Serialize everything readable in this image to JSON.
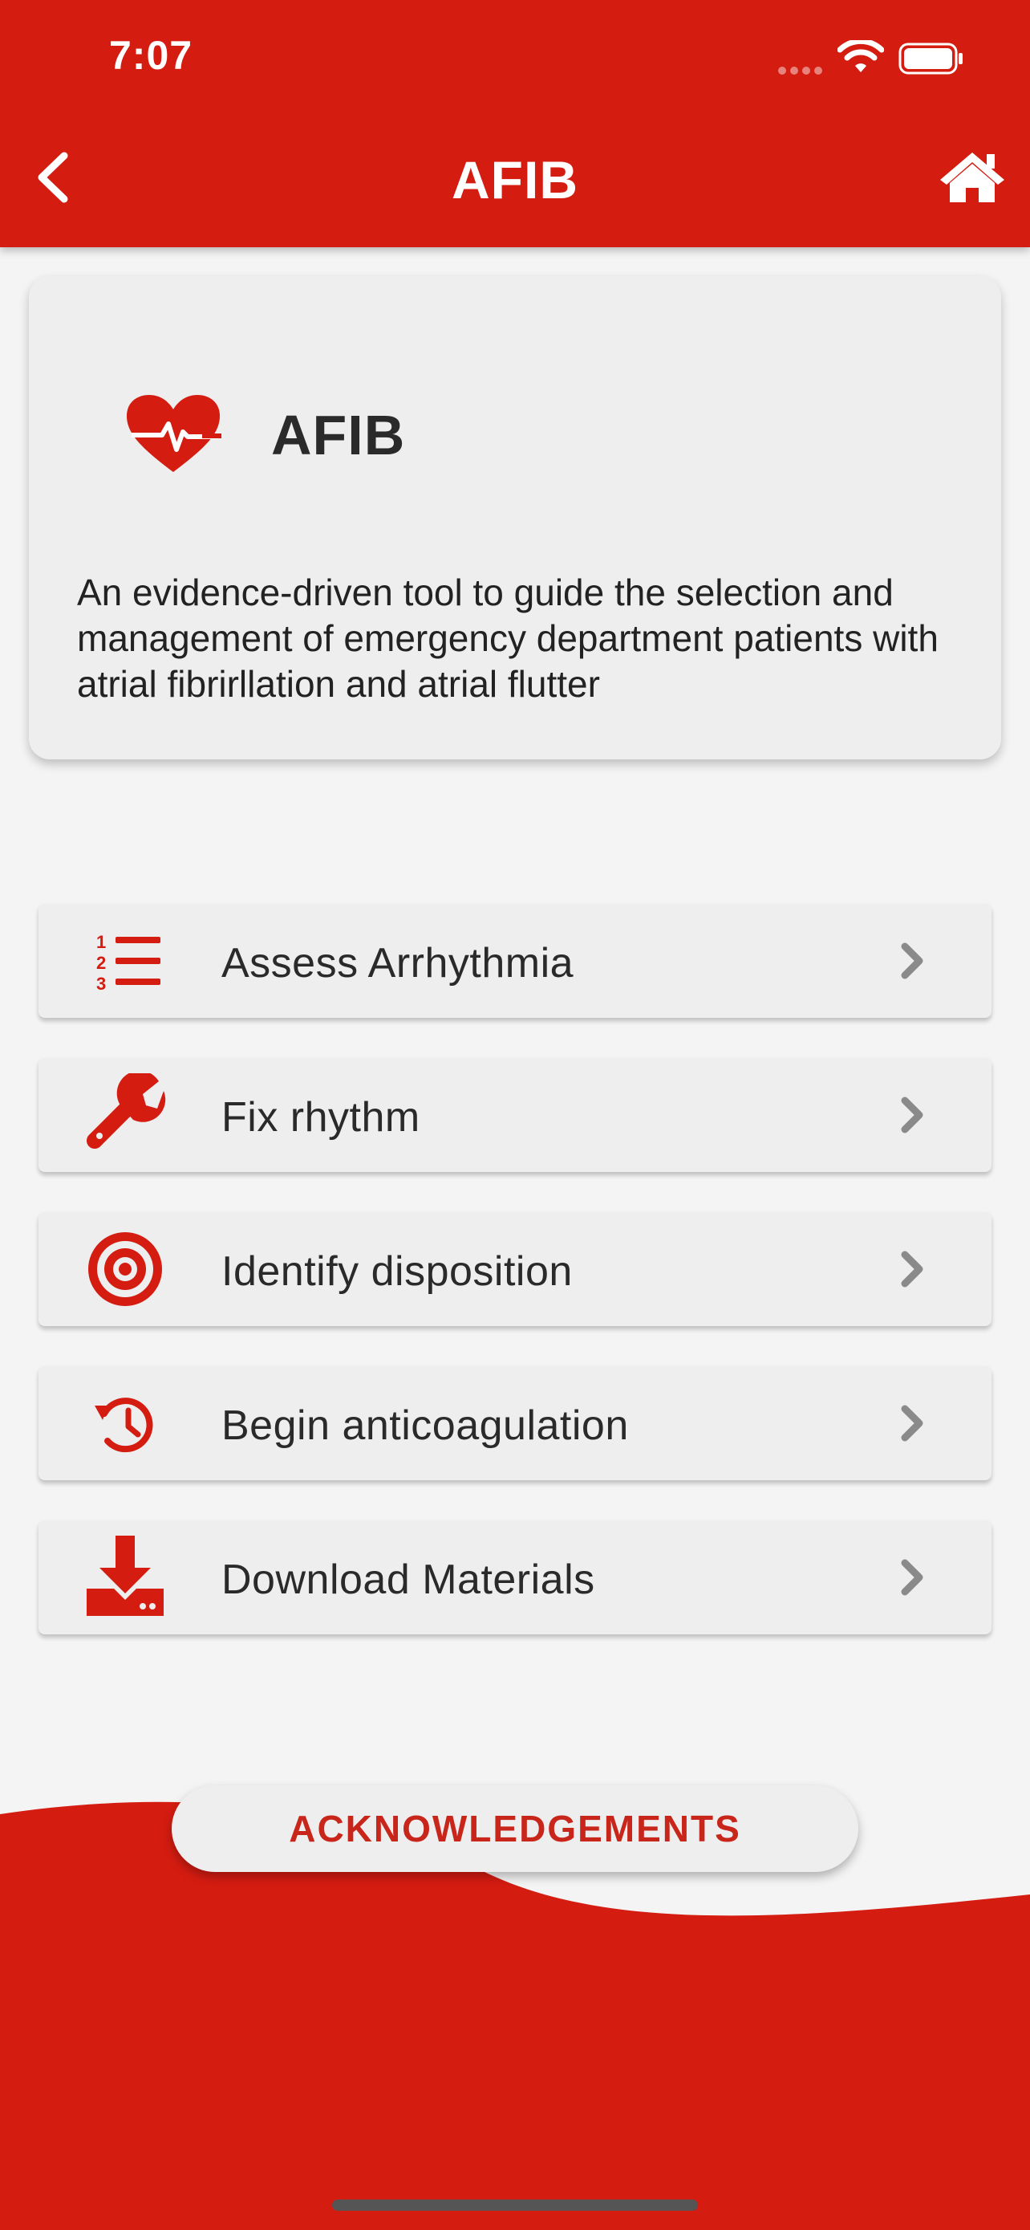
{
  "status_bar": {
    "time": "7:07"
  },
  "header": {
    "title": "AFIB"
  },
  "info_card": {
    "title": "AFIB",
    "description": "An evidence-driven tool to guide the selection and management of emergency department patients with atrial fibrirllation and atrial flutter"
  },
  "menu": {
    "items": [
      {
        "label": "Assess Arrhythmia",
        "icon": "numbered-list-icon"
      },
      {
        "label": "Fix rhythm",
        "icon": "wrench-icon"
      },
      {
        "label": "Identify disposition",
        "icon": "target-icon"
      },
      {
        "label": "Begin anticoagulation",
        "icon": "history-clock-icon"
      },
      {
        "label": "Download Materials",
        "icon": "download-icon"
      }
    ]
  },
  "footer": {
    "acknowledgements_label": "ACKNOWLEDGEMENTS"
  },
  "colors": {
    "brand": "#d41c11",
    "card": "#eeeeee",
    "background": "#f4f4f4",
    "chevron": "#8a8a8a"
  }
}
